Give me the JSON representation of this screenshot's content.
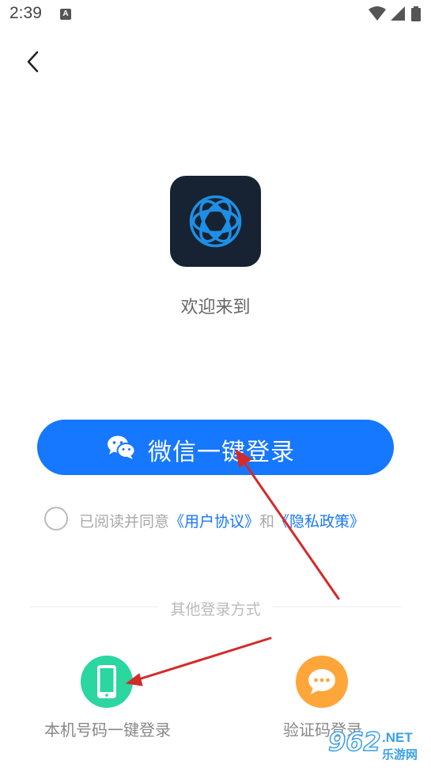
{
  "status_bar": {
    "time": "2:39",
    "notification_badge": "A",
    "icons": [
      "wifi-icon",
      "signal-icon",
      "battery-icon"
    ]
  },
  "header": {
    "back_icon": "chevron-left-icon"
  },
  "logo": {
    "icon": "app-logo-icon",
    "background": "#172332",
    "accent": "#1e8fe6"
  },
  "welcome_text": "欢迎来到",
  "primary_login": {
    "label": "微信一键登录",
    "icon": "wechat-icon",
    "color": "#1677ff"
  },
  "agreement": {
    "prefix": "已阅读并同意",
    "user_agreement": "《用户协议》",
    "conjunction": "和",
    "privacy_policy": "《隐私政策》",
    "checked": false
  },
  "other_login": {
    "title": "其他登录方式",
    "options": [
      {
        "label": "本机号码一键登录",
        "icon": "phone-icon",
        "color": "#2bd6a0"
      },
      {
        "label": "验证码登录",
        "icon": "chat-bubble-icon",
        "color": "#ffa63b"
      }
    ]
  },
  "annotation_color": "#d42a2a",
  "watermark": {
    "number": "962",
    "suffix": ".NET",
    "site": "乐游网"
  }
}
